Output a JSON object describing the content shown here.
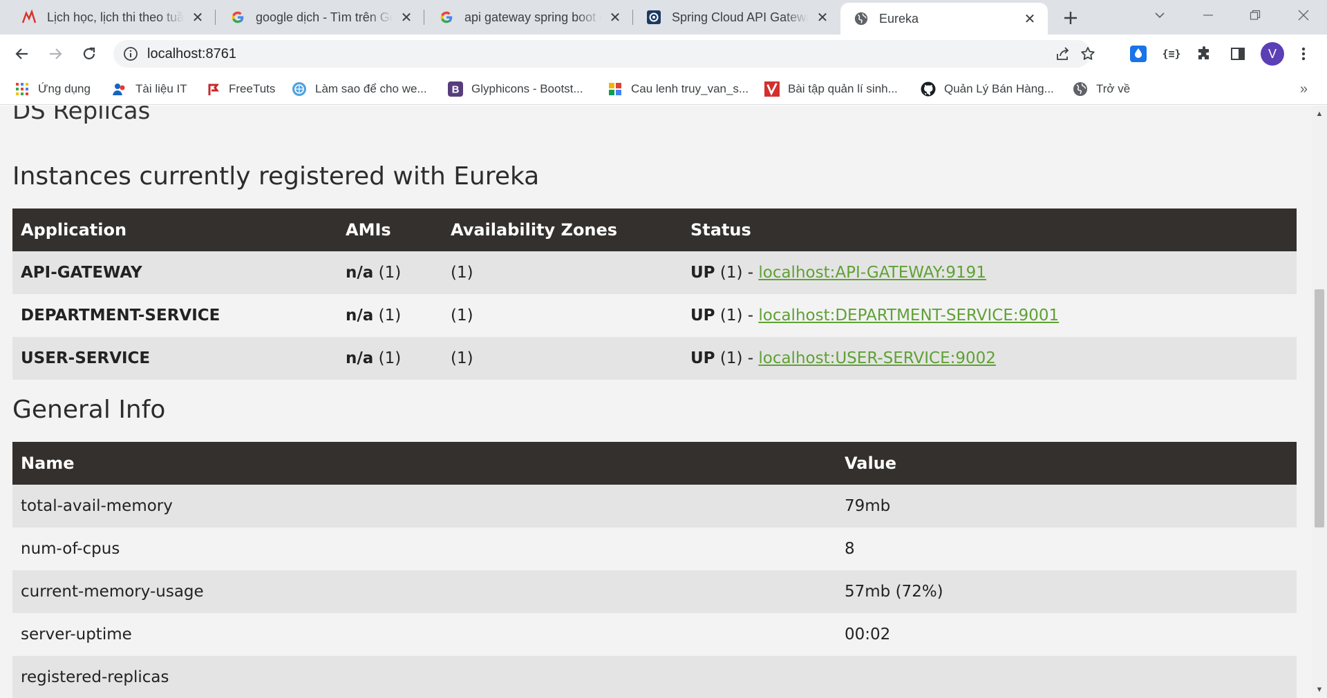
{
  "browser": {
    "tabs": [
      {
        "title": "Lịch học, lịch thi theo tuần",
        "icon": "ictu-logo-icon"
      },
      {
        "title": "google dịch - Tìm trên Google",
        "icon": "google-icon"
      },
      {
        "title": "api gateway spring boot example",
        "icon": "google-icon"
      },
      {
        "title": "Spring Cloud API Gateway",
        "icon": "spring-doc-icon"
      },
      {
        "title": "Eureka",
        "icon": "globe-icon",
        "active": true
      }
    ],
    "url": "localhost:8761",
    "profile_initial": "V",
    "colors": {
      "tabstrip": "#dee1e6",
      "profile": "#5b3fb5",
      "ext_blue": "#1a73e8"
    }
  },
  "bookmarks": [
    {
      "label": "Ứng dụng",
      "icon": "apps-grid-icon"
    },
    {
      "label": "Tài liệu IT",
      "icon": "people-icon"
    },
    {
      "label": "FreeTuts",
      "icon": "freetuts-icon"
    },
    {
      "label": "Làm sao để cho we...",
      "icon": "globe-badge-icon"
    },
    {
      "label": "Glyphicons - Bootst...",
      "icon": "bootstrap-icon"
    },
    {
      "label": "Cau lenh truy_van_s...",
      "icon": "sql-icon"
    },
    {
      "label": "Bài tập quản lí sinh...",
      "icon": "v-logo-icon"
    },
    {
      "label": "Quản Lý Bán Hàng...",
      "icon": "github-icon"
    },
    {
      "label": "Trở về",
      "icon": "globe-icon"
    }
  ],
  "page": {
    "replicas_heading": "DS Replicas",
    "instances_heading": "Instances currently registered with Eureka",
    "instances": {
      "headers": [
        "Application",
        "AMIs",
        "Availability Zones",
        "Status"
      ],
      "rows": [
        {
          "app": "API-GATEWAY",
          "ami_bold": "n/a",
          "ami_count": " (1)",
          "zones": "(1)",
          "status_prefix": "UP",
          "status_count": " (1) - ",
          "link": "localhost:API-GATEWAY:9191"
        },
        {
          "app": "DEPARTMENT-SERVICE",
          "ami_bold": "n/a",
          "ami_count": " (1)",
          "zones": "(1)",
          "status_prefix": "UP",
          "status_count": " (1) - ",
          "link": "localhost:DEPARTMENT-SERVICE:9001"
        },
        {
          "app": "USER-SERVICE",
          "ami_bold": "n/a",
          "ami_count": " (1)",
          "zones": "(1)",
          "status_prefix": "UP",
          "status_count": " (1) - ",
          "link": "localhost:USER-SERVICE:9002"
        }
      ]
    },
    "general_heading": "General Info",
    "general": {
      "headers": [
        "Name",
        "Value"
      ],
      "rows": [
        {
          "name": "total-avail-memory",
          "value": "79mb"
        },
        {
          "name": "num-of-cpus",
          "value": "8"
        },
        {
          "name": "current-memory-usage",
          "value": "57mb (72%)"
        },
        {
          "name": "server-uptime",
          "value": "00:02"
        },
        {
          "name": "registered-replicas",
          "value": ""
        }
      ]
    },
    "colors": {
      "header_bg": "#34302d",
      "link": "#5fa134",
      "row_odd": "#e4e4e4",
      "row_even": "#f3f3f3"
    }
  }
}
